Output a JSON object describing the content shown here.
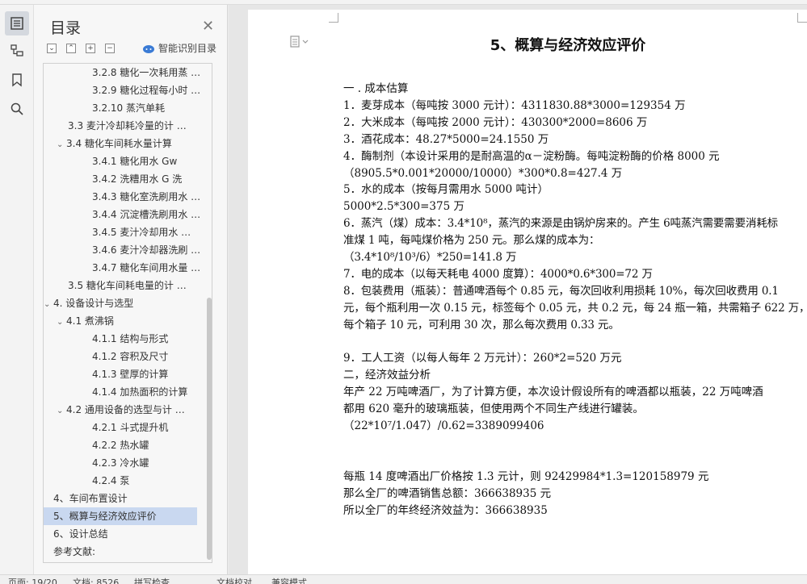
{
  "outline": {
    "title": "目录",
    "smart_label": "智能识别目录",
    "items": [
      {
        "label": "3.2.8  糖化一次耗用蒸 …",
        "level": 3
      },
      {
        "label": "3.2.9  糖化过程每小时 …",
        "level": 3
      },
      {
        "label": "3.2.10  蒸汽单耗",
        "level": 3
      },
      {
        "label": "3.3  麦汁冷却耗冷量的计 …",
        "level": 2
      },
      {
        "label": "3.4    糖化车间耗水量计算",
        "level": 2,
        "caret": "⌄"
      },
      {
        "label": "3.4.1    糖化用水 Gw",
        "level": 3
      },
      {
        "label": "3.4.2    洗糟用水 G 洗",
        "level": 3
      },
      {
        "label": "3.4.3  糖化室洗刷用水 …",
        "level": 3
      },
      {
        "label": "3.4.4  沉淀槽洗刷用水 …",
        "level": 3
      },
      {
        "label": "3.4.5    麦汁冷却用水 …",
        "level": 3
      },
      {
        "label": "3.4.6  麦汁冷却器洗刷 …",
        "level": 3
      },
      {
        "label": "3.4.7 糖化车间用水量 …",
        "level": 3
      },
      {
        "label": "3.5  糖化车间耗电量的计 …",
        "level": 2
      },
      {
        "label": "4.  设备设计与选型",
        "level": 1,
        "caret": "⌄"
      },
      {
        "label": "4.1    煮沸锅",
        "level": 2,
        "caret": "⌄"
      },
      {
        "label": "4.1.1    结构与形式",
        "level": 3
      },
      {
        "label": "4.1.2    容积及尺寸",
        "level": 3
      },
      {
        "label": "4.1.3  壁厚的计算",
        "level": 3
      },
      {
        "label": "4.1.4  加热面积的计算",
        "level": 3
      },
      {
        "label": "4.2  通用设备的选型与计 …",
        "level": 2,
        "caret": "⌄"
      },
      {
        "label": "4.2.1    斗式提升机",
        "level": 3
      },
      {
        "label": "4.2.2    热水罐",
        "level": 3
      },
      {
        "label": "4.2.3    冷水罐",
        "level": 3
      },
      {
        "label": "4.2.4    泵",
        "level": 3
      },
      {
        "label": "4、车间布置设计",
        "level": 1
      },
      {
        "label": "5、概算与经济效应评价",
        "level": 1,
        "selected": true
      },
      {
        "label": "6、设计总结",
        "level": 1
      },
      {
        "label": "参考文献:",
        "level": 1
      }
    ]
  },
  "document": {
    "title": "5、概算与经济效应评价",
    "lines": [
      "一 . 成本估算",
      "1．麦芽成本（每吨按 3000 元计）：4311830.88*3000=129354 万",
      "2．大米成本（每吨按 2000 元计）：430300*2000=8606 万",
      "3．酒花成本：48.27*5000=24.1550 万",
      "4．酶制剂（本设计采用的是耐高温的α－淀粉酶。每吨淀粉酶的价格 8000 元",
      "（8905.5*0.001*20000/10000）*300*0.8=427.4 万",
      "5．水的成本（按每月需用水 5000 吨计）",
      "5000*2.5*300=375 万",
      "6．蒸汽（煤）成本：3.4*10⁸，蒸汽的来源是由锅炉房来的。产生 6吨蒸汽需要需要消耗标",
      "准煤 1 吨，每吨煤价格为 250 元。那么煤的成本为：",
      "（3.4*10⁸/10³/6）*250=141.8 万",
      "7．电的成本（以每天耗电 4000 度算）：4000*0.6*300=72 万",
      "8．包装费用（瓶装）：普通啤酒每个 0.85 元，每次回收利用损耗 10%，每次回收费用 0.1",
      "元，每个瓶利用一次 0.15 元，标签每个 0.05 元，共 0.2 元，每 24 瓶一箱，共需箱子 622 万，",
      "每个箱子 10 元，可利用 30 次，那么每次费用 0.33 元。",
      "",
      "9．工人工资（以每人每年 2 万元计）：260*2=520 万元",
      "二，经济效益分析",
      "    年产 22 万吨啤酒厂，为了计算方便，本次设计假设所有的啤酒都以瓶装，22 万吨啤酒",
      "都用 620 毫升的玻璃瓶装，但使用两个不同生产线进行罐装。",
      "            （22*10⁷/1.047）/0.62=3389099406",
      "",
      "",
      "每瓶 14 度啤酒出厂价格按  1.3  元计，则 92429984*1.3=120158979 元",
      "那么全厂的啤酒销售总额：366638935 元",
      "所以全厂的年终经济效益为：366638935"
    ]
  },
  "status": {
    "page": "页面: 19/20",
    "words": "文档: 8526",
    "spell": "拼写检查",
    "proof": "文档校对",
    "compat": "兼容模式"
  }
}
